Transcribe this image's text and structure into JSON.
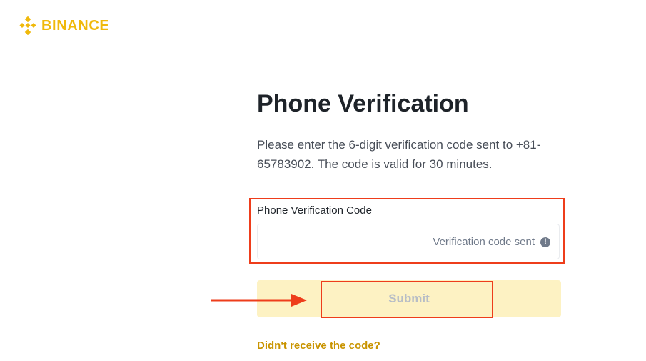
{
  "brand": {
    "name": "BINANCE",
    "logo_icon": "binance-diamond-icon",
    "color": "#F0B90B"
  },
  "page": {
    "title": "Phone Verification",
    "description": "Please enter the 6-digit verification code sent to +81-65783902. The code is valid for 30 minutes."
  },
  "form": {
    "code_label": "Phone Verification Code",
    "code_value": "",
    "code_status": "Verification code sent",
    "status_icon": "info-circle-icon",
    "submit_label": "Submit",
    "submit_enabled": false,
    "resend_link": "Didn't receive the code?"
  },
  "annotations": {
    "highlight_color": "#EE3D1B",
    "arrow_icon": "arrow-right-icon"
  }
}
